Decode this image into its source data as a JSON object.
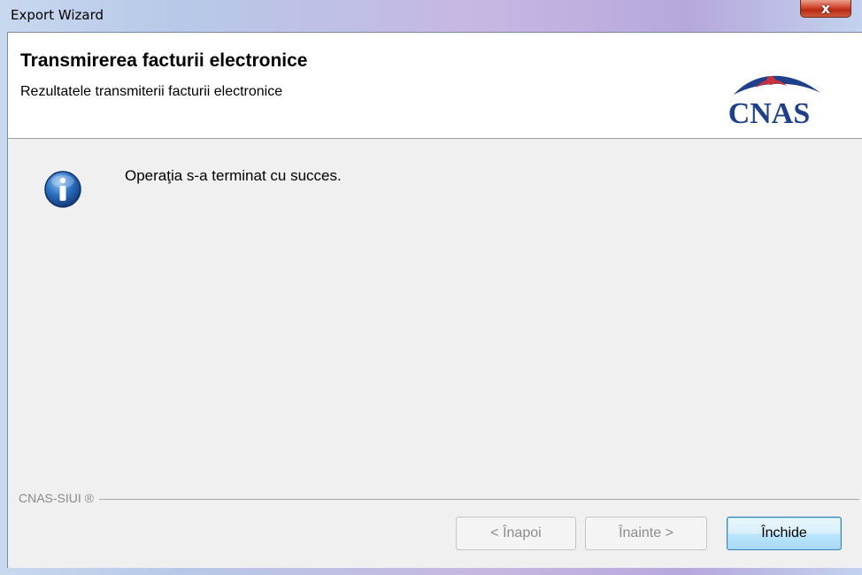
{
  "window": {
    "title": "Export Wizard",
    "close_glyph": "x"
  },
  "header": {
    "title": "Transmirerea facturii electronice",
    "subtitle": "Rezultatele transmiterii facturii electronice",
    "logo_text": "CNAS"
  },
  "body": {
    "icon": "info-icon",
    "message": "Operaţia s-a terminat cu succes."
  },
  "footer": {
    "label": "CNAS-SIUI ®"
  },
  "buttons": {
    "back": "< Înapoi",
    "next": "Înainte >",
    "close": "Închide"
  },
  "colors": {
    "logo_blue": "#1e3f8a",
    "logo_red": "#c8323c",
    "info_blue": "#2a6dc0"
  }
}
